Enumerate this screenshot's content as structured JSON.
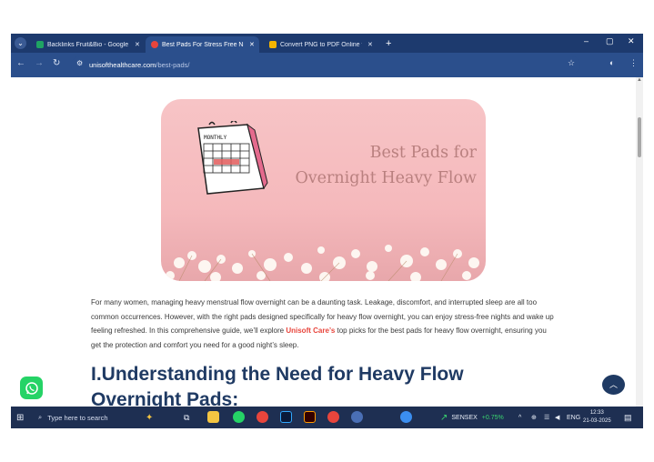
{
  "browser": {
    "tabs": [
      {
        "title": "Backlinks Fruit&Bio - Google Sh",
        "favicon_color": "#1fa463",
        "active": false
      },
      {
        "title": "Best Pads For Stress Free Night",
        "favicon_color": "#e8453c",
        "active": true
      },
      {
        "title": "Convert PNG to PDF Online for",
        "favicon_color": "#f4b400",
        "active": false
      }
    ],
    "new_tab": "+",
    "url_domain": "unisofthealthcare.com",
    "url_path": "/best-pads/",
    "window_controls": {
      "minimize": "–",
      "maximize": "▢",
      "close": "✕"
    }
  },
  "hero": {
    "title_line1": "Best Pads for",
    "title_line2": "Overnight Heavy Flow",
    "calendar_label": "MONTHLY"
  },
  "article": {
    "intro_before": "For many women, managing heavy menstrual flow overnight can be a daunting task. Leakage, discomfort, and interrupted sleep are all too common occurrences. However, with the right pads designed specifically for heavy flow overnight, you can enjoy stress-free nights and wake up feeling refreshed. In this comprehensive guide, we’ll explore ",
    "brand": "Unisoft Care’s",
    "intro_after": " top picks for the best pads for heavy flow overnight, ensuring you get the protection and comfort you need for a good night’s sleep.",
    "heading_line1": "I.Understanding the Need for Heavy Flow",
    "heading_line2": "Overnight Pads:"
  },
  "taskbar": {
    "search_placeholder": "Type here to search",
    "ticker_name": "SENSEX",
    "ticker_change": "+0.75%",
    "language": "ENG",
    "time": "12:33",
    "date": "21-03-2025"
  },
  "colors": {
    "accent": "#1f3a63",
    "brand": "#e8453c",
    "hero_bg": "#f5b9bc",
    "browser_frame": "#1d3a6e"
  }
}
